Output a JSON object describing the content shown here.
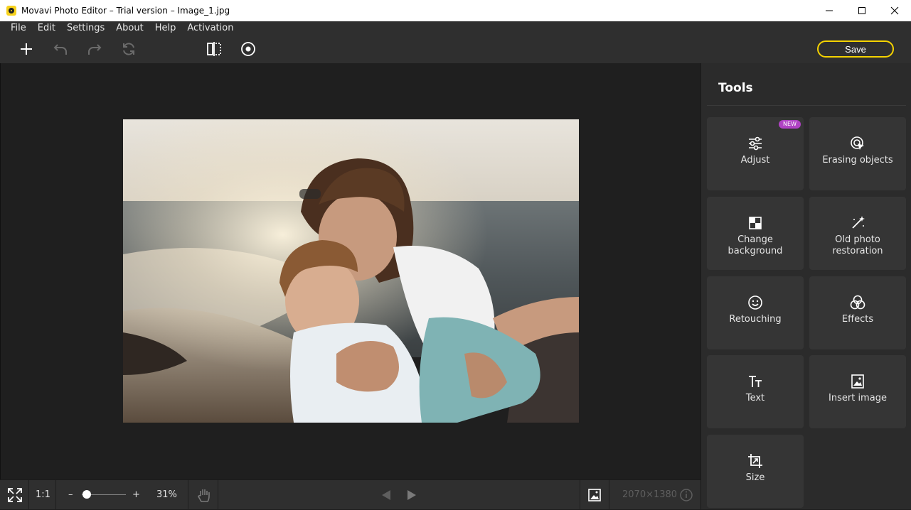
{
  "window": {
    "title": "Movavi Photo Editor – Trial version – Image_1.jpg"
  },
  "menu": [
    {
      "label": "File"
    },
    {
      "label": "Edit"
    },
    {
      "label": "Settings"
    },
    {
      "label": "About"
    },
    {
      "label": "Help"
    },
    {
      "label": "Activation"
    }
  ],
  "toolbar": {
    "save_label": "Save",
    "icons": [
      "plus-icon",
      "undo-icon",
      "redo-icon",
      "reset-icon",
      "compare-icon",
      "preview-eye-icon"
    ]
  },
  "tools": {
    "title": "Tools",
    "items": [
      {
        "label": "Adjust",
        "badge": "NEW",
        "icon": "adjust-sliders-icon"
      },
      {
        "label": "Erasing objects",
        "icon": "erase-cursor-icon"
      },
      {
        "label": "Change\nbackground",
        "icon": "background-checker-icon"
      },
      {
        "label": "Old photo\nrestoration",
        "icon": "magic-wand-icon"
      },
      {
        "label": "Retouching",
        "icon": "smiley-icon"
      },
      {
        "label": "Effects",
        "icon": "effects-circles-icon"
      },
      {
        "label": "Text",
        "icon": "text-tt-icon"
      },
      {
        "label": "Insert image",
        "icon": "insert-image-icon"
      },
      {
        "label": "Size",
        "icon": "crop-resize-icon"
      }
    ]
  },
  "status": {
    "ratio": "1:1",
    "zoom_minus": "–",
    "zoom_plus": "+",
    "zoom_percent": "31%",
    "zoom_level": 0.31,
    "dimensions": "2070×1380"
  },
  "colors": {
    "accent": "#f5d300",
    "badge": "#b042c4",
    "panel": "#2b2b2b",
    "card": "#353535"
  }
}
